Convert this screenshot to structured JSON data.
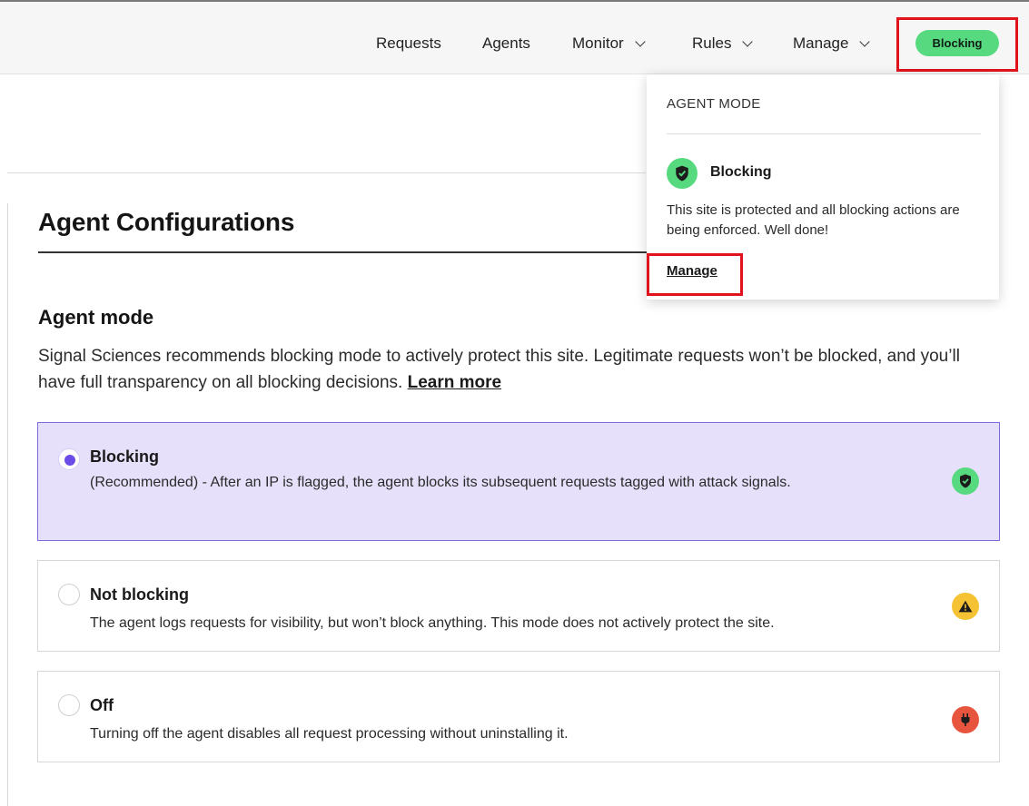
{
  "nav": {
    "items": [
      {
        "label": "Requests",
        "has_dropdown": false
      },
      {
        "label": "Agents",
        "has_dropdown": false
      },
      {
        "label": "Monitor",
        "has_dropdown": true
      },
      {
        "label": "Rules",
        "has_dropdown": true
      },
      {
        "label": "Manage",
        "has_dropdown": true
      }
    ],
    "mode_badge": "Blocking"
  },
  "popover": {
    "heading": "AGENT MODE",
    "mode_label": "Blocking",
    "description": "This site is protected and all blocking actions are being enforced. Well done!",
    "manage_link": "Manage"
  },
  "page": {
    "title": "Agent Configurations",
    "section_title": "Agent mode",
    "section_desc": "Signal Sciences recommends blocking mode to actively protect this site. Legitimate requests won’t be blocked, and you’ll have full transparency on all blocking decisions.",
    "learn_more": "Learn more"
  },
  "options": [
    {
      "title": "Blocking",
      "desc": "(Recommended) - After an IP is flagged, the agent blocks its subsequent requests tagged with attack signals.",
      "selected": true,
      "icon": "shield-check-icon",
      "icon_color": "#57d97f"
    },
    {
      "title": "Not blocking",
      "desc": "The agent logs requests for visibility, but won’t block anything. This mode does not actively protect the site.",
      "selected": false,
      "icon": "warning-icon",
      "icon_color": "#f5c233"
    },
    {
      "title": "Off",
      "desc": "Turning off the agent disables all request processing without uninstalling it.",
      "selected": false,
      "icon": "plug-icon",
      "icon_color": "#e8553f"
    }
  ],
  "colors": {
    "accent": "#6b4ce6",
    "blocking_green": "#57d97f",
    "highlight_red": "#e0131d"
  }
}
